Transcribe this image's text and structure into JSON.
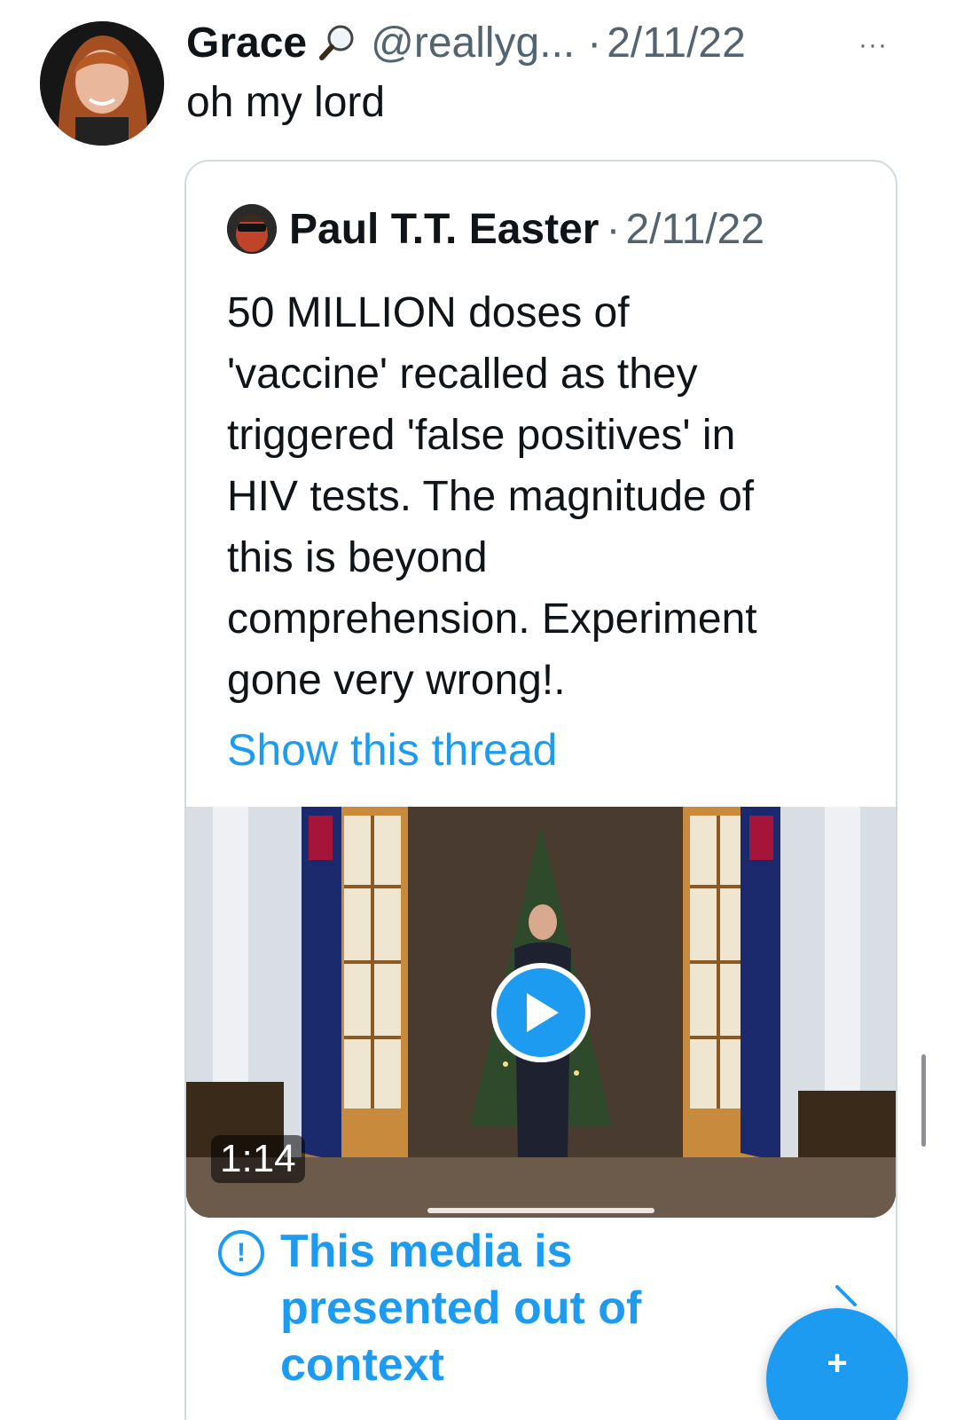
{
  "tweet": {
    "author": {
      "display_name": "Grace",
      "name_emoji": "🔎",
      "handle": "@reallyg...",
      "date": "2/11/22",
      "separator": "·"
    },
    "more_label": "···",
    "text": "oh my lord"
  },
  "quoted_tweet": {
    "author": {
      "display_name": "Paul T.T. Easter",
      "date": "2/11/22",
      "separator": "·"
    },
    "text_lines": [
      "50 MILLION doses of",
      "'vaccine' recalled as they",
      "triggered 'false positives' in",
      "HIV tests. The magnitude of",
      "this is beyond",
      "comprehension. Experiment",
      "gone very wrong!."
    ],
    "show_thread_label": "Show this thread",
    "media": {
      "type": "video",
      "duration": "1:14",
      "play_icon": "play-icon"
    },
    "context_note": {
      "icon": "exclamation-circle-icon",
      "lines": [
        "This media is",
        "presented out of",
        "context"
      ]
    }
  },
  "compose_button": {
    "icon": "feather-plus-icon",
    "label": "+"
  },
  "colors": {
    "accent": "#1d9bf0",
    "text_primary": "#0f1419",
    "text_secondary": "#536471",
    "border": "#cfd9de"
  }
}
